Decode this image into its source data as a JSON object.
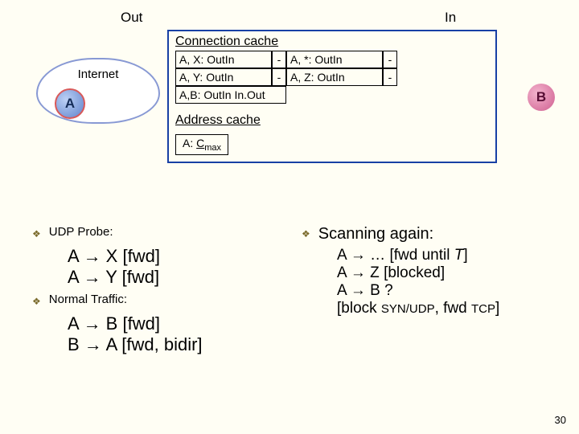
{
  "top": {
    "out": "Out",
    "in": "In"
  },
  "nodes": {
    "internet": "Internet",
    "A": "A",
    "B": "B"
  },
  "cache": {
    "conn_heading": "Connection cache",
    "addr_heading": "Address cache",
    "r1c1": "A, X: OutIn",
    "r1c2": "-",
    "r1c3": "A, *: OutIn",
    "r1c4": "-",
    "r2c1": "A, Y: OutIn",
    "r2c2": "-",
    "r2c3": "A, Z: OutIn",
    "r2c4": "-",
    "r3": "A,B: OutIn In.Out",
    "addr_cell_a": "A:",
    "addr_cell_c": "C",
    "addr_cell_m": "max"
  },
  "left": {
    "h1": "UDP Probe:",
    "l1": "A → X  [fwd]",
    "l2": "A → Y  [fwd]",
    "h2": "Normal Traffic:",
    "l3": "A → B  [fwd]",
    "l4": "B → A  [fwd, bidir]"
  },
  "right": {
    "h": "Scanning again:",
    "l1a": "A → …  [fwd until ",
    "l1b": "T",
    "l1c": "]",
    "l2": "A → Z   [blocked]",
    "l3": "A → B   ?",
    "l4a": "[block ",
    "l4b": "SYN/UDP",
    "l4c": ", fwd ",
    "l4d": "TCP",
    "l4e": "]"
  },
  "slide": "30"
}
